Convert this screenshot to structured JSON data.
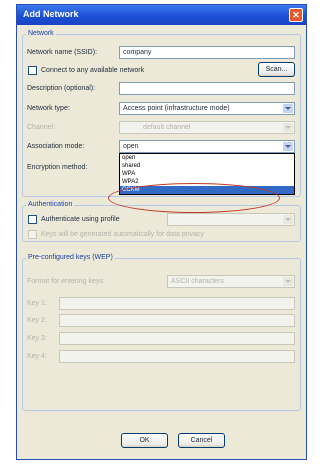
{
  "window": {
    "title": "Add Network"
  },
  "network": {
    "group_label": "Network",
    "ssid_label": "Network name (SSID):",
    "ssid_value": "company",
    "connect_any_label": "Connect to any available network",
    "scan_button": "Scan...",
    "description_label": "Description (optional):",
    "description_value": "",
    "type_label": "Network type:",
    "type_value": "Access point (infrastructure mode)",
    "channel_label": "Channel:",
    "channel_value": "default channel",
    "association_label": "Association mode:",
    "association_value": "open",
    "encryption_label": "Encryption method:",
    "association_options": [
      "open",
      "shared",
      "WPA",
      "WPA2",
      "CCKM"
    ],
    "selected_option_index": 4
  },
  "authentication": {
    "group_label": "Authentication",
    "use_profile_label": "Authenticate using profile",
    "keys_note": "Keys will be generated automatically for data privacy"
  },
  "wep": {
    "group_label": "Pre-configured keys (WEP)",
    "format_label": "Format for entering keys:",
    "format_value": "ASCII characters",
    "keys": [
      "Key 1:",
      "Key 2:",
      "Key 3:",
      "Key 4:"
    ]
  },
  "buttons": {
    "ok": "OK",
    "cancel": "Cancel"
  },
  "annotation_color": "#c0392b"
}
